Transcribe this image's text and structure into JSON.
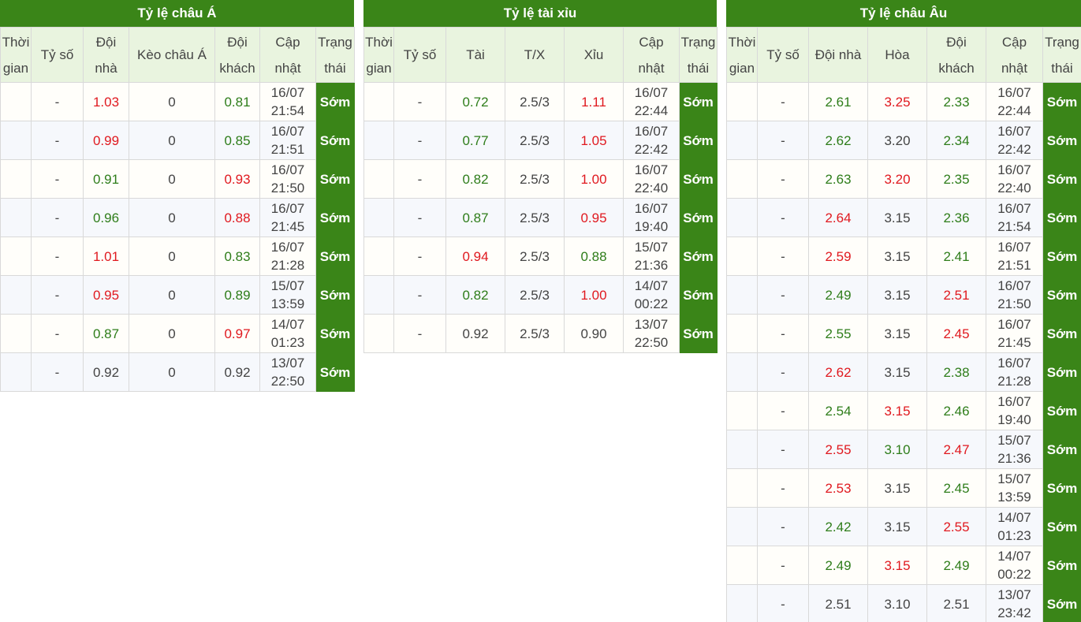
{
  "asian": {
    "title": "Tỷ lệ châu Á",
    "headers": [
      {
        "l1": "Thời",
        "l2": "gian"
      },
      {
        "l1": "Tỷ số",
        "l2": ""
      },
      {
        "l1": "Đội",
        "l2": "nhà"
      },
      {
        "l1": "Kèo châu Á",
        "l2": ""
      },
      {
        "l1": "Đội",
        "l2": "khách"
      },
      {
        "l1": "Cập",
        "l2": "nhật"
      },
      {
        "l1": "Trạng",
        "l2": "thái"
      }
    ],
    "rows": [
      {
        "time": "",
        "score": "-",
        "home": "1.03",
        "home_color": "red",
        "line": "0",
        "away": "0.81",
        "away_color": "green",
        "date": "16/07",
        "clock": "21:54",
        "status": "Sớm"
      },
      {
        "time": "",
        "score": "-",
        "home": "0.99",
        "home_color": "red",
        "line": "0",
        "away": "0.85",
        "away_color": "green",
        "date": "16/07",
        "clock": "21:51",
        "status": "Sớm"
      },
      {
        "time": "",
        "score": "-",
        "home": "0.91",
        "home_color": "green",
        "line": "0",
        "away": "0.93",
        "away_color": "red",
        "date": "16/07",
        "clock": "21:50",
        "status": "Sớm"
      },
      {
        "time": "",
        "score": "-",
        "home": "0.96",
        "home_color": "green",
        "line": "0",
        "away": "0.88",
        "away_color": "red",
        "date": "16/07",
        "clock": "21:45",
        "status": "Sớm"
      },
      {
        "time": "",
        "score": "-",
        "home": "1.01",
        "home_color": "red",
        "line": "0",
        "away": "0.83",
        "away_color": "green",
        "date": "16/07",
        "clock": "21:28",
        "status": "Sớm"
      },
      {
        "time": "",
        "score": "-",
        "home": "0.95",
        "home_color": "red",
        "line": "0",
        "away": "0.89",
        "away_color": "green",
        "date": "15/07",
        "clock": "13:59",
        "status": "Sớm"
      },
      {
        "time": "",
        "score": "-",
        "home": "0.87",
        "home_color": "green",
        "line": "0",
        "away": "0.97",
        "away_color": "red",
        "date": "14/07",
        "clock": "01:23",
        "status": "Sớm"
      },
      {
        "time": "",
        "score": "-",
        "home": "0.92",
        "home_color": "default",
        "line": "0",
        "away": "0.92",
        "away_color": "default",
        "date": "13/07",
        "clock": "22:50",
        "status": "Sớm"
      }
    ]
  },
  "overunder": {
    "title": "Tỷ lệ tài xỉu",
    "headers": [
      {
        "l1": "Thời",
        "l2": "gian"
      },
      {
        "l1": "Tỷ số",
        "l2": ""
      },
      {
        "l1": "Tài",
        "l2": ""
      },
      {
        "l1": "T/X",
        "l2": ""
      },
      {
        "l1": "Xỉu",
        "l2": ""
      },
      {
        "l1": "Cập",
        "l2": "nhật"
      },
      {
        "l1": "Trạng",
        "l2": "thái"
      }
    ],
    "rows": [
      {
        "time": "",
        "score": "-",
        "over": "0.72",
        "over_color": "green",
        "line": "2.5/3",
        "under": "1.11",
        "under_color": "red",
        "date": "16/07",
        "clock": "22:44",
        "status": "Sớm"
      },
      {
        "time": "",
        "score": "-",
        "over": "0.77",
        "over_color": "green",
        "line": "2.5/3",
        "under": "1.05",
        "under_color": "red",
        "date": "16/07",
        "clock": "22:42",
        "status": "Sớm"
      },
      {
        "time": "",
        "score": "-",
        "over": "0.82",
        "over_color": "green",
        "line": "2.5/3",
        "under": "1.00",
        "under_color": "red",
        "date": "16/07",
        "clock": "22:40",
        "status": "Sớm"
      },
      {
        "time": "",
        "score": "-",
        "over": "0.87",
        "over_color": "green",
        "line": "2.5/3",
        "under": "0.95",
        "under_color": "red",
        "date": "16/07",
        "clock": "19:40",
        "status": "Sớm"
      },
      {
        "time": "",
        "score": "-",
        "over": "0.94",
        "over_color": "red",
        "line": "2.5/3",
        "under": "0.88",
        "under_color": "green",
        "date": "15/07",
        "clock": "21:36",
        "status": "Sớm"
      },
      {
        "time": "",
        "score": "-",
        "over": "0.82",
        "over_color": "green",
        "line": "2.5/3",
        "under": "1.00",
        "under_color": "red",
        "date": "14/07",
        "clock": "00:22",
        "status": "Sớm"
      },
      {
        "time": "",
        "score": "-",
        "over": "0.92",
        "over_color": "default",
        "line": "2.5/3",
        "under": "0.90",
        "under_color": "default",
        "date": "13/07",
        "clock": "22:50",
        "status": "Sớm"
      }
    ]
  },
  "european": {
    "title": "Tỷ lệ châu Âu",
    "headers": [
      {
        "l1": "Thời",
        "l2": "gian"
      },
      {
        "l1": "Tỷ số",
        "l2": ""
      },
      {
        "l1": "Đội nhà",
        "l2": ""
      },
      {
        "l1": "Hòa",
        "l2": ""
      },
      {
        "l1": "Đội",
        "l2": "khách"
      },
      {
        "l1": "Cập",
        "l2": "nhật"
      },
      {
        "l1": "Trạng",
        "l2": "thái"
      }
    ],
    "rows": [
      {
        "time": "",
        "score": "-",
        "home": "2.61",
        "home_color": "green",
        "draw": "3.25",
        "draw_color": "red",
        "away": "2.33",
        "away_color": "green",
        "date": "16/07",
        "clock": "22:44",
        "status": "Sớm"
      },
      {
        "time": "",
        "score": "-",
        "home": "2.62",
        "home_color": "green",
        "draw": "3.20",
        "draw_color": "default",
        "away": "2.34",
        "away_color": "green",
        "date": "16/07",
        "clock": "22:42",
        "status": "Sớm"
      },
      {
        "time": "",
        "score": "-",
        "home": "2.63",
        "home_color": "green",
        "draw": "3.20",
        "draw_color": "red",
        "away": "2.35",
        "away_color": "green",
        "date": "16/07",
        "clock": "22:40",
        "status": "Sớm"
      },
      {
        "time": "",
        "score": "-",
        "home": "2.64",
        "home_color": "red",
        "draw": "3.15",
        "draw_color": "default",
        "away": "2.36",
        "away_color": "green",
        "date": "16/07",
        "clock": "21:54",
        "status": "Sớm"
      },
      {
        "time": "",
        "score": "-",
        "home": "2.59",
        "home_color": "red",
        "draw": "3.15",
        "draw_color": "default",
        "away": "2.41",
        "away_color": "green",
        "date": "16/07",
        "clock": "21:51",
        "status": "Sớm"
      },
      {
        "time": "",
        "score": "-",
        "home": "2.49",
        "home_color": "green",
        "draw": "3.15",
        "draw_color": "default",
        "away": "2.51",
        "away_color": "red",
        "date": "16/07",
        "clock": "21:50",
        "status": "Sớm"
      },
      {
        "time": "",
        "score": "-",
        "home": "2.55",
        "home_color": "green",
        "draw": "3.15",
        "draw_color": "default",
        "away": "2.45",
        "away_color": "red",
        "date": "16/07",
        "clock": "21:45",
        "status": "Sớm"
      },
      {
        "time": "",
        "score": "-",
        "home": "2.62",
        "home_color": "red",
        "draw": "3.15",
        "draw_color": "default",
        "away": "2.38",
        "away_color": "green",
        "date": "16/07",
        "clock": "21:28",
        "status": "Sớm"
      },
      {
        "time": "",
        "score": "-",
        "home": "2.54",
        "home_color": "green",
        "draw": "3.15",
        "draw_color": "red",
        "away": "2.46",
        "away_color": "green",
        "date": "16/07",
        "clock": "19:40",
        "status": "Sớm"
      },
      {
        "time": "",
        "score": "-",
        "home": "2.55",
        "home_color": "red",
        "draw": "3.10",
        "draw_color": "green",
        "away": "2.47",
        "away_color": "red",
        "date": "15/07",
        "clock": "21:36",
        "status": "Sớm"
      },
      {
        "time": "",
        "score": "-",
        "home": "2.53",
        "home_color": "red",
        "draw": "3.15",
        "draw_color": "default",
        "away": "2.45",
        "away_color": "green",
        "date": "15/07",
        "clock": "13:59",
        "status": "Sớm"
      },
      {
        "time": "",
        "score": "-",
        "home": "2.42",
        "home_color": "green",
        "draw": "3.15",
        "draw_color": "default",
        "away": "2.55",
        "away_color": "red",
        "date": "14/07",
        "clock": "01:23",
        "status": "Sớm"
      },
      {
        "time": "",
        "score": "-",
        "home": "2.49",
        "home_color": "green",
        "draw": "3.15",
        "draw_color": "red",
        "away": "2.49",
        "away_color": "green",
        "date": "14/07",
        "clock": "00:22",
        "status": "Sớm"
      },
      {
        "time": "",
        "score": "-",
        "home": "2.51",
        "home_color": "default",
        "draw": "3.10",
        "draw_color": "default",
        "away": "2.51",
        "away_color": "default",
        "date": "13/07",
        "clock": "23:42",
        "status": "Sớm"
      }
    ]
  }
}
